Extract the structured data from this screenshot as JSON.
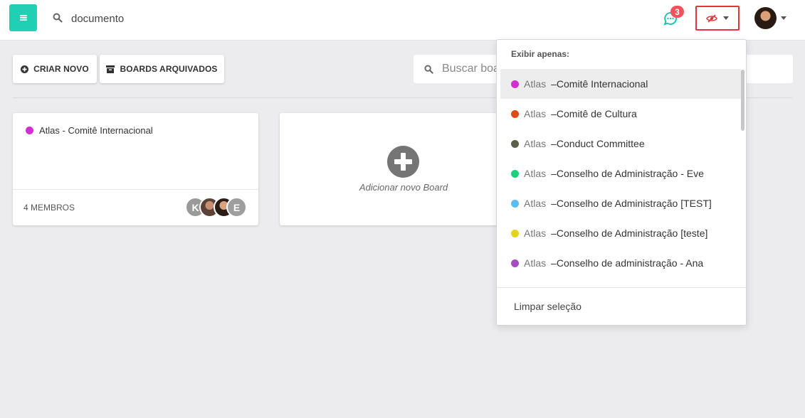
{
  "topbar": {
    "search_value": "documento",
    "notifications_count": "3",
    "colors": {
      "menu": "#1fd0b4",
      "badge": "#f0525a",
      "filter_highlight": "#e0353c"
    }
  },
  "toolbar": {
    "create_label": "CRIAR NOVO",
    "archived_label": "BOARDS ARQUIVADOS",
    "search_placeholder": "Buscar boards"
  },
  "boards": [
    {
      "title": "Atlas - Comitê Internacional",
      "color": "#d12fd1",
      "members_label": "4 MEMBROS",
      "member_initials": [
        "K",
        "E"
      ]
    }
  ],
  "add_board_label": "Adicionar novo Board",
  "dropdown": {
    "header": "Exibir apenas:",
    "items": [
      {
        "prefix": "Atlas",
        "name": "–Comitê Internacional",
        "color": "#d12fd1"
      },
      {
        "prefix": "Atlas",
        "name": "–Comitê de Cultura",
        "color": "#e04a16"
      },
      {
        "prefix": "Atlas",
        "name": "–Conduct Committee",
        "color": "#5b5f45"
      },
      {
        "prefix": "Atlas",
        "name": "–Conselho de Administração - Eve",
        "color": "#1ad17a"
      },
      {
        "prefix": "Atlas",
        "name": "–Conselho de Administração [TEST]",
        "color": "#58bdf0"
      },
      {
        "prefix": "Atlas",
        "name": "–Conselho de Administração [teste]",
        "color": "#e5d31a"
      },
      {
        "prefix": "Atlas",
        "name": "–Conselho de administração - Ana",
        "color": "#a74bc4"
      }
    ],
    "clear_label": "Limpar seleção"
  }
}
